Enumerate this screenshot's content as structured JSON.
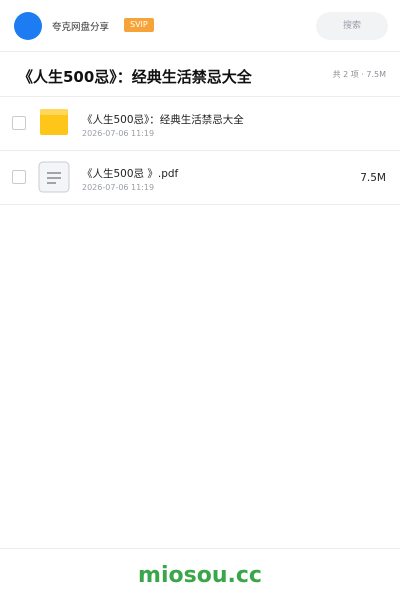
{
  "header": {
    "brand": "夸克网盘分享",
    "badge": "SVIP",
    "search_placeholder": "搜索"
  },
  "share": {
    "title": "《人生500忌》：经典生活禁忌大全",
    "summary": "共 2 项 · 7.5M"
  },
  "files": [
    {
      "name": "《人生500忌》：经典生活禁忌大全",
      "date": "2026-07-06 11:19",
      "size": "",
      "icon": "folder-icon"
    },
    {
      "name": "《人生500忌 》.pdf",
      "date": "2026-07-06 11:19",
      "size": "7.5M",
      "icon": "document-icon"
    }
  ],
  "footer": {
    "site": "miosou.cc"
  },
  "colors": {
    "accent": "#1e7cf2",
    "badge": "#f6a33a",
    "folder": "#ffc61a",
    "site": "#3aa64a"
  }
}
